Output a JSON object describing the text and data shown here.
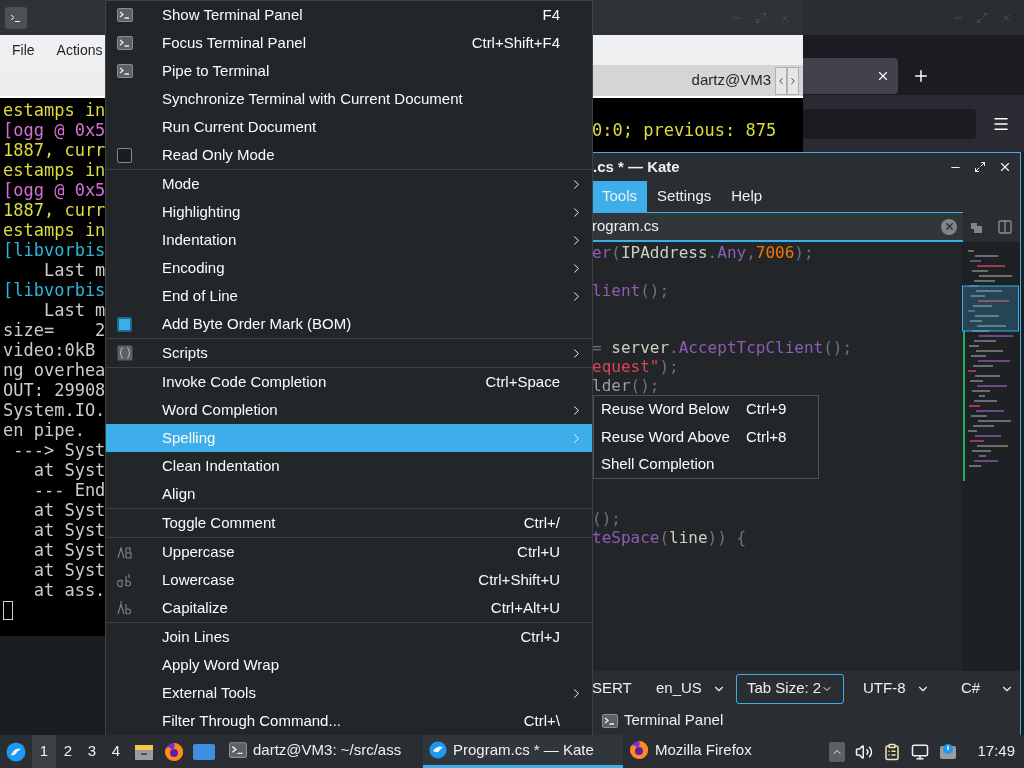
{
  "terminal": {
    "menus": [
      {
        "label": "File"
      },
      {
        "label": "Actions"
      }
    ],
    "tab": {
      "title": "dartz@VM3"
    },
    "left_lines": [
      {
        "text": "estamps in",
        "color": "#dcdc3c"
      },
      {
        "text": "[ogg @ 0x5",
        "color": "#d670d6"
      },
      {
        "text": "1887, curr",
        "color": "#dcdc3c"
      },
      {
        "text": "estamps in",
        "color": "#dcdc3c"
      },
      {
        "text": "[ogg @ 0x5",
        "color": "#d670d6"
      },
      {
        "text": "1887, curr",
        "color": "#dcdc3c"
      },
      {
        "text": "estamps in",
        "color": "#dcdc3c"
      },
      {
        "text": "[libvorbis",
        "color": "#29b8db"
      },
      {
        "text": "    Last m",
        "color": "#cccccc"
      },
      {
        "text": "[libvorbis",
        "color": "#29b8db"
      },
      {
        "text": "    Last m",
        "color": "#cccccc"
      },
      {
        "text": "size=    2",
        "color": "#cccccc"
      },
      {
        "text": "video:0kB",
        "color": "#cccccc"
      },
      {
        "text": "ng overhea",
        "color": "#cccccc"
      },
      {
        "text": "OUT: 29908",
        "color": "#cccccc"
      },
      {
        "text": "System.IO.",
        "color": "#cccccc"
      },
      {
        "text": "en pipe.",
        "color": "#cccccc"
      },
      {
        "text": " ---> Syst",
        "color": "#cccccc"
      },
      {
        "text": "   at Syst",
        "color": "#cccccc"
      },
      {
        "text": "   --- End",
        "color": "#cccccc"
      },
      {
        "text": "   at Syst",
        "color": "#cccccc"
      },
      {
        "text": "   at Syst",
        "color": "#cccccc"
      },
      {
        "text": "   at Syst",
        "color": "#cccccc"
      },
      {
        "text": "   at Syst",
        "color": "#cccccc"
      },
      {
        "text": "   at ass.",
        "color": "#cccccc"
      }
    ],
    "right_lines": [
      {
        "text": "0:0; previous: 875",
        "color": "#dcdc3c"
      }
    ]
  },
  "context_menu": {
    "groups": [
      [
        {
          "kind": "terminal",
          "label": "Show Terminal Panel",
          "shortcut": "F4",
          "submenu": false,
          "selected": false
        },
        {
          "kind": "terminal",
          "label": "Focus Terminal Panel",
          "shortcut": "Ctrl+Shift+F4",
          "submenu": false,
          "selected": false
        },
        {
          "kind": "terminal",
          "label": "Pipe to Terminal",
          "submenu": false,
          "selected": false
        },
        {
          "kind": "plain",
          "label": "Synchronize Terminal with Current Document",
          "submenu": false,
          "selected": false
        },
        {
          "kind": "plain",
          "label": "Run Current Document",
          "submenu": false,
          "selected": false
        },
        {
          "kind": "check",
          "label": "Read Only Mode",
          "checked": false,
          "submenu": false,
          "selected": false
        }
      ],
      [
        {
          "kind": "plain",
          "label": "Mode",
          "submenu": true,
          "selected": false
        },
        {
          "kind": "plain",
          "label": "Highlighting",
          "submenu": true,
          "selected": false
        },
        {
          "kind": "plain",
          "label": "Indentation",
          "submenu": true,
          "selected": false
        },
        {
          "kind": "plain",
          "label": "Encoding",
          "submenu": true,
          "selected": false
        },
        {
          "kind": "plain",
          "label": "End of Line",
          "submenu": true,
          "selected": false
        },
        {
          "kind": "check",
          "label": "Add Byte Order Mark (BOM)",
          "checked": true,
          "submenu": false,
          "selected": false
        }
      ],
      [
        {
          "kind": "scripts",
          "label": "Scripts",
          "submenu": true,
          "selected": false
        }
      ],
      [
        {
          "kind": "plain",
          "label": "Invoke Code Completion",
          "shortcut": "Ctrl+Space",
          "submenu": false,
          "selected": false
        },
        {
          "kind": "plain",
          "label": "Word Completion",
          "submenu": true,
          "selected": false
        },
        {
          "kind": "plain",
          "label": "Spelling",
          "submenu": true,
          "selected": true
        },
        {
          "kind": "plain",
          "label": "Clean Indentation",
          "submenu": false,
          "selected": false
        },
        {
          "kind": "plain",
          "label": "Align",
          "submenu": false,
          "selected": false
        }
      ],
      [
        {
          "kind": "plain",
          "label": "Toggle Comment",
          "shortcut": "Ctrl+/",
          "submenu": false,
          "selected": false
        }
      ],
      [
        {
          "kind": "upper",
          "label": "Uppercase",
          "shortcut": "Ctrl+U",
          "submenu": false,
          "selected": false
        },
        {
          "kind": "lower",
          "label": "Lowercase",
          "shortcut": "Ctrl+Shift+U",
          "submenu": false,
          "selected": false
        },
        {
          "kind": "capital",
          "label": "Capitalize",
          "shortcut": "Ctrl+Alt+U",
          "submenu": false,
          "selected": false
        }
      ],
      [
        {
          "kind": "plain",
          "label": "Join Lines",
          "shortcut": "Ctrl+J",
          "submenu": false,
          "selected": false
        },
        {
          "kind": "plain",
          "label": "Apply Word Wrap",
          "submenu": false,
          "selected": false
        },
        {
          "kind": "plain",
          "label": "External Tools",
          "submenu": true,
          "selected": false
        },
        {
          "kind": "plain",
          "label": "Filter Through Command...",
          "shortcut": "Ctrl+\\",
          "submenu": false,
          "selected": false
        }
      ]
    ]
  },
  "submenu": {
    "items": [
      {
        "label": "Reuse Word Below",
        "shortcut": "Ctrl+9"
      },
      {
        "label": "Reuse Word Above",
        "shortcut": "Ctrl+8"
      },
      {
        "label": "Shell Completion"
      }
    ]
  },
  "kate": {
    "title": ".cs * — Kate",
    "menus": [
      {
        "label": "Tools",
        "selected": true
      },
      {
        "label": "Settings",
        "selected": false
      },
      {
        "label": "Help",
        "selected": false
      }
    ],
    "tab": "rogram.cs",
    "code_lines": [
      {
        "kind": "code",
        "segments": [
          {
            "text": "er",
            "color": "#8e5bb5"
          },
          {
            "text": "(",
            "color": "#6e7378"
          },
          {
            "text": "IPAddress",
            "color": "#cfcfc2"
          },
          {
            "text": ".Any",
            "color": "#8e5bb5"
          },
          {
            "text": ",",
            "color": "#6e7378"
          },
          {
            "text": "7006",
            "color": "#f67400"
          },
          {
            "text": ");",
            "color": "#6e7378"
          }
        ]
      },
      {
        "kind": "blank"
      },
      {
        "kind": "code",
        "segments": [
          {
            "text": "lient",
            "color": "#8e5bb5"
          },
          {
            "text": "();",
            "color": "#6e7378"
          }
        ]
      },
      {
        "kind": "blank"
      },
      {
        "kind": "blank"
      },
      {
        "kind": "code",
        "segments": [
          {
            "text": "=",
            "color": "#6e7378"
          },
          {
            "text": " server",
            "color": "#cfcfc2"
          },
          {
            "text": ".AcceptTcpClient",
            "color": "#8e5bb5"
          },
          {
            "text": "();",
            "color": "#6e7378"
          }
        ]
      },
      {
        "kind": "code",
        "segments": [
          {
            "text": "equest\"",
            "color": "#da4453"
          },
          {
            "text": ");",
            "color": "#6e7378"
          }
        ]
      },
      {
        "kind": "code",
        "segments": [
          {
            "text": "lder",
            "color": "#9a9c9e"
          },
          {
            "text": "();",
            "color": "#6e7378"
          }
        ]
      },
      {
        "kind": "blank"
      },
      {
        "kind": "blank"
      },
      {
        "kind": "blank"
      },
      {
        "kind": "blank"
      },
      {
        "kind": "blank"
      },
      {
        "kind": "blank"
      },
      {
        "kind": "code",
        "segments": [
          {
            "text": "();",
            "color": "#6e7378"
          }
        ]
      },
      {
        "kind": "code",
        "segments": [
          {
            "text": "teSpace",
            "color": "#8e5bb5"
          },
          {
            "text": "(",
            "color": "#6e7378"
          },
          {
            "text": "line",
            "color": "#cfcfc2"
          },
          {
            "text": ")) {",
            "color": "#6e7378"
          }
        ]
      }
    ],
    "status": {
      "mode": "SERT",
      "dictionary": "en_US",
      "tab_size": "Tab Size: 2",
      "encoding": "UTF-8",
      "language": "C#"
    },
    "terminal_panel": "Terminal Panel"
  },
  "taskbar": {
    "pager": [
      {
        "label": "1",
        "selected": true
      },
      {
        "label": "2",
        "selected": false
      },
      {
        "label": "3",
        "selected": false
      },
      {
        "label": "4",
        "selected": false
      }
    ],
    "tasks": [
      {
        "kind": "terminal",
        "label": "dartz@VM3: ~/src/ass",
        "selected": false
      },
      {
        "kind": "kate",
        "label": "Program.cs * — Kate",
        "selected": true
      },
      {
        "kind": "firefox",
        "label": "Mozilla Firefox",
        "selected": false
      }
    ],
    "clock": "17:49"
  }
}
